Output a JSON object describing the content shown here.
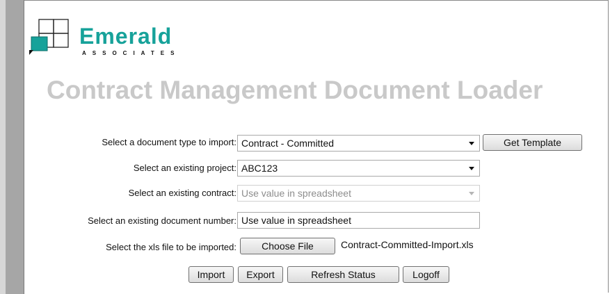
{
  "logo": {
    "brand_name": "Emerald",
    "brand_sub": "ASSOCIATES",
    "colors": {
      "primary": "#17a29a",
      "secondary": "#111111"
    }
  },
  "page_title": "Contract Management Document Loader",
  "form": {
    "document_type": {
      "label": "Select a document type to import:",
      "value": "Contract - Committed",
      "get_template_label": "Get Template"
    },
    "project": {
      "label": "Select an existing project:",
      "value": "ABC123"
    },
    "contract": {
      "label": "Select an existing contract:",
      "value": "Use value in spreadsheet",
      "disabled": true
    },
    "document_number": {
      "label": "Select an existing document number:",
      "value": "Use value in spreadsheet"
    },
    "file": {
      "label": "Select the xls file to be imported:",
      "button_label": "Choose File",
      "file_name": "Contract-Committed-Import.xls"
    }
  },
  "actions": {
    "import_label": "Import",
    "export_label": "Export",
    "refresh_label": "Refresh Status",
    "logoff_label": "Logoff"
  }
}
